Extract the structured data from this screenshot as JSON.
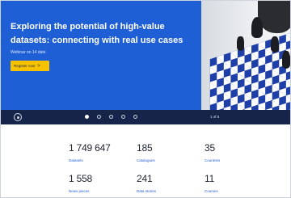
{
  "hero": {
    "title": "Exploring the potential of high-value datasets: connecting with real use cases",
    "subtitle": "Webinar on 14 date",
    "register_label": "Register now",
    "register_arrow": ">"
  },
  "carousel": {
    "counter": "1 of 5",
    "slide_count": 5,
    "active_index": 0
  },
  "stats": [
    {
      "value": "1 749 647",
      "label": "Datasets"
    },
    {
      "value": "185",
      "label": "Catalogues"
    },
    {
      "value": "35",
      "label": "Countries"
    },
    {
      "value": "1 558",
      "label": "News pieces"
    },
    {
      "value": "241",
      "label": "Data stories"
    },
    {
      "value": "11",
      "label": "Courses"
    }
  ],
  "colors": {
    "hero_bg": "#1f5fd6",
    "nav_bg": "#16244a",
    "button": "#f6c200",
    "label": "#1f5fd6"
  },
  "icons": [
    "pause-icon",
    "chevron-right-icon"
  ]
}
